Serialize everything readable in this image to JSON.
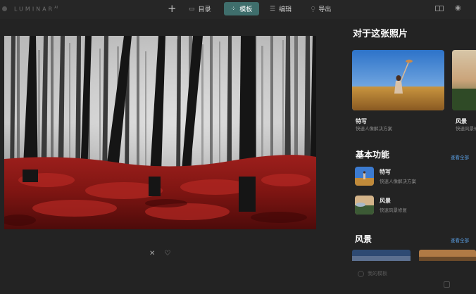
{
  "app": {
    "title": "LUMINAR",
    "version_mark": "AI"
  },
  "toolbar": {
    "add_icon": "plus-icon",
    "tabs": [
      {
        "label": "目录",
        "icon": "folder-icon",
        "active": false
      },
      {
        "label": "模板",
        "icon": "templates-icon",
        "active": true
      },
      {
        "label": "编辑",
        "icon": "sliders-icon",
        "active": false
      },
      {
        "label": "导出",
        "icon": "export-icon",
        "active": false
      }
    ],
    "right_icons": [
      "compare-icon",
      "eye-icon"
    ],
    "accent": "#3f6e6c"
  },
  "photo": {
    "actions": {
      "reject": "✕",
      "favorite": "♡"
    }
  },
  "panel": {
    "for_this_photo": {
      "title": "对于这张照片",
      "cards": [
        {
          "name": "特写",
          "subtitle": "快速人像解决方案"
        },
        {
          "name": "风景",
          "subtitle": "快速风景修复"
        }
      ]
    },
    "basic": {
      "title": "基本功能",
      "see_all": "查看全部",
      "items": [
        {
          "name": "特写",
          "subtitle": "快速人像解决方案"
        },
        {
          "name": "风景",
          "subtitle": "快速风景修复"
        }
      ]
    },
    "landscape": {
      "title": "风景",
      "see_all": "查看全部"
    },
    "my_templates": "我的模板",
    "link_color": "#5aa0e6"
  }
}
